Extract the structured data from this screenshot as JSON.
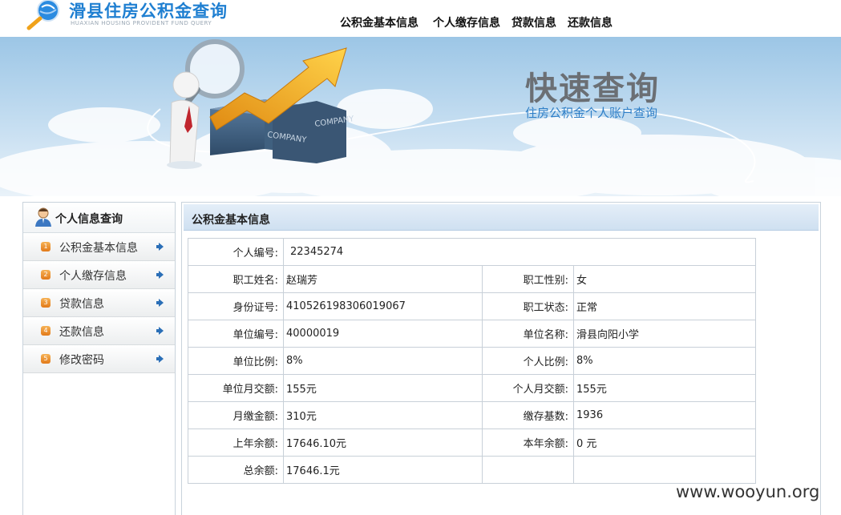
{
  "header": {
    "logo_title": "滑县住房公积金查询",
    "logo_subtitle": "HUAXIAN HOUSING PROVIDENT FUND QUERY",
    "nav": [
      "公积金基本信息",
      "个人缴存信息",
      "贷款信息",
      "还款信息"
    ]
  },
  "banner": {
    "title": "快速查询",
    "subtitle": "住房公积金个人账户查询",
    "box_text_1": "COMPANY",
    "box_text_2": "COMPANY"
  },
  "sidebar": {
    "title": "个人信息查询",
    "items": [
      {
        "num": "1",
        "label": "公积金基本信息"
      },
      {
        "num": "2",
        "label": "个人缴存信息"
      },
      {
        "num": "3",
        "label": "贷款信息"
      },
      {
        "num": "4",
        "label": "还款信息"
      },
      {
        "num": "5",
        "label": "修改密码"
      }
    ]
  },
  "content": {
    "title": "公积金基本信息",
    "rows": [
      {
        "l1": "个人编号:",
        "v1": "22345274"
      },
      {
        "l1": "职工姓名:",
        "v1": "赵瑞芳",
        "l2": "职工性别:",
        "v2": "女"
      },
      {
        "l1": "身份证号:",
        "v1": "410526198306019067",
        "l2": "职工状态:",
        "v2": "正常"
      },
      {
        "l1": "单位编号:",
        "v1": "40000019",
        "l2": "单位名称:",
        "v2": "滑县向阳小学"
      },
      {
        "l1": "单位比例:",
        "v1": "8%",
        "l2": "个人比例:",
        "v2": "8%"
      },
      {
        "l1": "单位月交额:",
        "v1": "155元",
        "l2": "个人月交额:",
        "v2": "155元"
      },
      {
        "l1": "月缴金额:",
        "v1": "310元",
        "l2": "缴存基数:",
        "v2": "1936"
      },
      {
        "l1": "上年余额:",
        "v1": "17646.10元",
        "l2": "本年余额:",
        "v2": "0 元"
      },
      {
        "l1": "总余额:",
        "v1": "17646.1元",
        "l2": "",
        "v2": ""
      }
    ]
  },
  "watermark": "www.wooyun.org",
  "colors": {
    "brand_blue": "#1f7fd1",
    "banner_sky": "#bcd8ee",
    "accent_orange": "#e27a1a",
    "arrow_gold": "#f2b21c"
  },
  "icons": [
    "magnifier-logo-icon",
    "user-icon",
    "chevron-right-icon"
  ]
}
